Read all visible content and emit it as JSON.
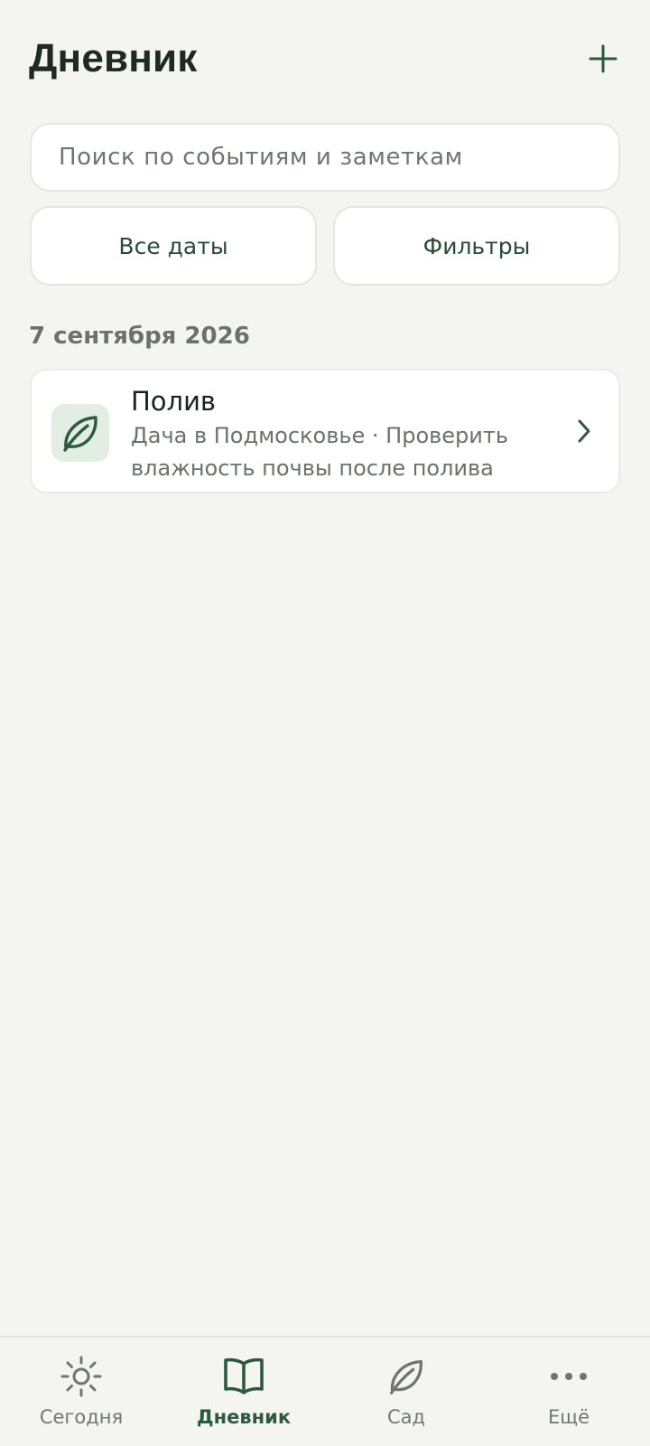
{
  "header": {
    "title": "Дневник",
    "add_icon": "plus-icon"
  },
  "search": {
    "placeholder": "Поиск по событиям и заметкам",
    "value": ""
  },
  "filters": {
    "dates_label": "Все даты",
    "filters_label": "Фильтры"
  },
  "groups": [
    {
      "date": "7 сентября 2026",
      "events": [
        {
          "title": "Полив",
          "subtitle_line1": "Дача в Подмосковье · Проверить",
          "subtitle_line2": "влажность почвы после полива",
          "icon": "leaf-icon"
        }
      ]
    }
  ],
  "bottom_nav": {
    "items": [
      {
        "label": "Сегодня",
        "icon": "sun-icon",
        "active": false
      },
      {
        "label": "Дневник",
        "icon": "book-icon",
        "active": true
      },
      {
        "label": "Сад",
        "icon": "leaf-icon",
        "active": false
      },
      {
        "label": "Ещё",
        "icon": "more-dots-icon",
        "active": false
      }
    ]
  },
  "colors": {
    "background": "#f4f4f0",
    "accent": "#2d5a3d",
    "icon_bg": "#e2ede4",
    "muted_text": "#6b716c"
  }
}
